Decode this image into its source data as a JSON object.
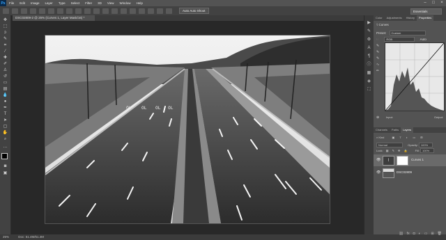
{
  "menu": {
    "logo": "Ps",
    "items": [
      "File",
      "Edit",
      "Image",
      "Layer",
      "Type",
      "Select",
      "Filter",
      "3D",
      "View",
      "Window",
      "Help"
    ]
  },
  "window_controls": {
    "minimize": "–",
    "maximize": "□",
    "close": "×"
  },
  "options_bar": {
    "auto_button": "Auto Auto Shoot"
  },
  "workspace": {
    "label": "Essentials"
  },
  "document": {
    "tab_title": "DSC02809-2 @ 25% (Curves 1, Layer Mask/16) *"
  },
  "status": {
    "zoom": "25%",
    "doc_info": "Doc: 51.4M/51.4M"
  },
  "properties_panel": {
    "tabs": [
      "Color",
      "Adjustments",
      "History",
      "Properties"
    ],
    "active_tab": "Properties",
    "title": "Curves",
    "preset_label": "Preset:",
    "preset_value": "Custom",
    "channel_value": "RGB",
    "auto_label": "Auto",
    "input_label": "Input:",
    "output_label": "Output:"
  },
  "layers_panel": {
    "tabs": [
      "Channels",
      "Paths",
      "Layers"
    ],
    "active_tab": "Layers",
    "kind_label": "Kind",
    "blend_mode": "Normal",
    "opacity_label": "Opacity:",
    "opacity_value": "100%",
    "lock_label": "Lock:",
    "fill_label": "Fill:",
    "fill_value": "100%",
    "layers": [
      {
        "name": "Curves 1",
        "selected": true
      },
      {
        "name": "DSC02809",
        "selected": false
      }
    ]
  },
  "colors": {
    "accent_logo": "#33a4ff",
    "ui_bg": "#535353",
    "canvas_bg": "#282828"
  }
}
